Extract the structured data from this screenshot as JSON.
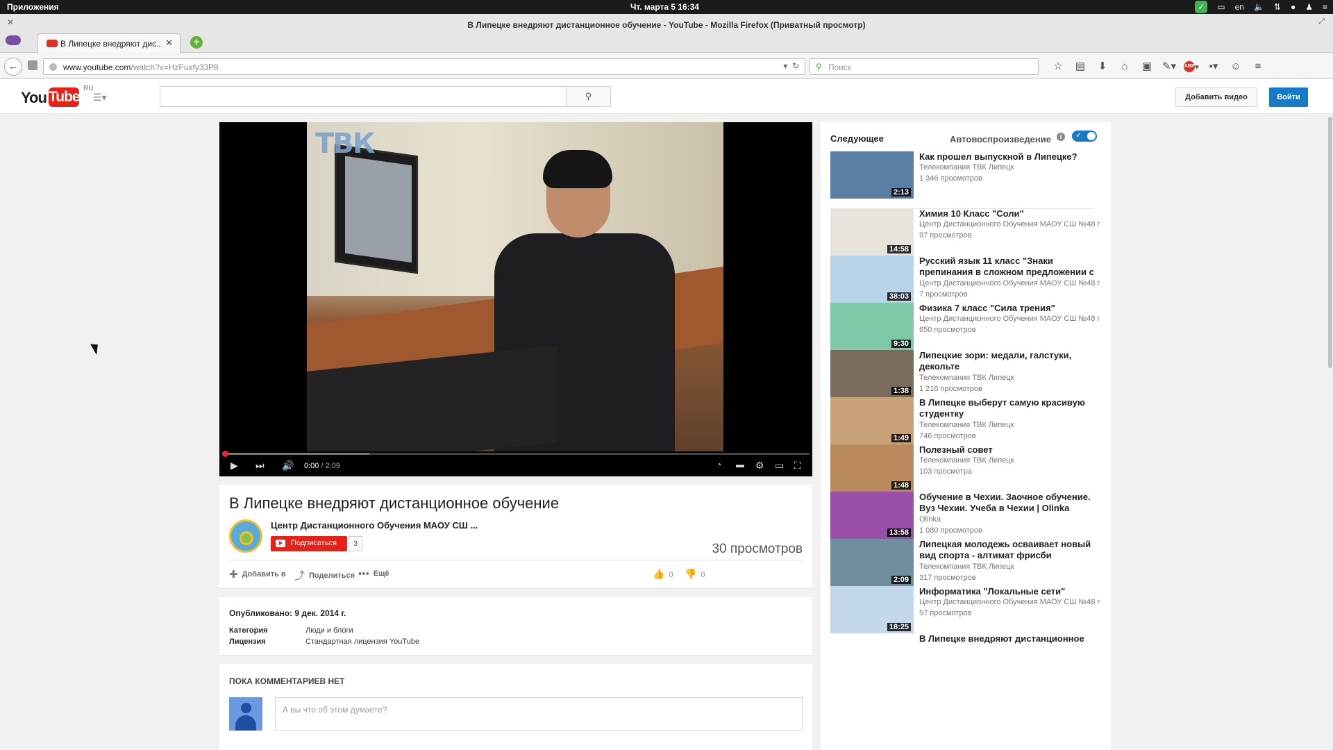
{
  "os": {
    "apps_menu": "Приложения",
    "clock": "Чт. марта  5 16:34",
    "tray": {
      "lang": "en"
    }
  },
  "window": {
    "title": "В Липецке внедряют дистанционное обучение - YouTube - Mozilla Firefox (Приватный просмотр)"
  },
  "tabs": [
    {
      "label": "В Липецке внедряют дис..."
    }
  ],
  "navbar": {
    "url_host": "www.youtube.com",
    "url_path": "/watch?v=HzFuxfy33P8",
    "search_placeholder": "Поиск"
  },
  "yt_header": {
    "logo_you": "You",
    "logo_tube": "Tube",
    "logo_region": "RU",
    "upload_label": "Добавить видео",
    "signin_label": "Войти"
  },
  "player": {
    "watermark": "ТВК",
    "current_time": "0:00",
    "duration": "/ 2:09",
    "progress": 0.0,
    "buffered": 0.25
  },
  "video": {
    "title": "В Липецке внедряют дистанционное обучение",
    "channel": "Центр Дистанционного Обучения МАОУ СШ ...",
    "subscribe_label": "Подписаться",
    "subscribers": "3",
    "views": "30 просмотров",
    "actions": {
      "add_to": "Добавить в",
      "share": "Поделиться",
      "more": "Ещё"
    },
    "likes": "0",
    "dislikes": "0"
  },
  "description": {
    "published": "Опубликовано: 9 дек. 2014 г.",
    "category_key": "Категория",
    "category_val": "Люди и блоги",
    "license_key": "Лицензия",
    "license_val": "Стандартная лицензия YouTube"
  },
  "comments": {
    "header": "ПОКА КОММЕНТАРИЕВ НЕТ",
    "placeholder": "А вы что об этом думаете?"
  },
  "sidebar": {
    "next_label": "Следующее",
    "autoplay_label": "Автовоспроизведение",
    "autoplay_on": true,
    "videos": [
      {
        "title": "Как прошел выпускной в Липецке?",
        "channel": "Телекомпания ТВК Липецк",
        "views": "1 346 просмотров",
        "duration": "2:13",
        "color": "#5b7fa3"
      },
      {
        "title": "Химия 10 Класс \"Соли\"",
        "channel": "Центр Дистанционного Обучения МАОУ СШ №48 г",
        "views": "97 просмотров",
        "duration": "14:58",
        "color": "#e8e4dc"
      },
      {
        "title": "Русский язык 11 класс \"Знаки препинания в сложном предложении с",
        "channel": "Центр Дистанционного Обучения МАОУ СШ №48 г",
        "views": "7 просмотров",
        "duration": "38:03",
        "color": "#b9d3ea"
      },
      {
        "title": "Физика 7 класс \"Сила трения\"",
        "channel": "Центр Дистанционного Обучения МАОУ СШ №48 г",
        "views": "650 просмотров",
        "duration": "9:30",
        "color": "#7fc8a8"
      },
      {
        "title": "Липецкие зори: медали, галстуки, декольте",
        "channel": "Телекомпания ТВК Липецк",
        "views": "1 216 просмотров",
        "duration": "1:38",
        "color": "#7a6c5d"
      },
      {
        "title": "В Липецке выберут самую красивую студентку",
        "channel": "Телекомпания ТВК Липецк",
        "views": "746 просмотров",
        "duration": "1:49",
        "color": "#c9a27a"
      },
      {
        "title": "Полезный совет",
        "channel": "Телекомпания ТВК Липецк",
        "views": "103 просмотра",
        "duration": "1:48",
        "color": "#b88a5c"
      },
      {
        "title": "Обучение в Чехии. Заочное обучение. Вуз Чехии. Учеба в Чехии | Olinka",
        "channel": "Olinka",
        "views": "1 080 просмотров",
        "duration": "13:58",
        "color": "#9a4fa8"
      },
      {
        "title": "Липецкая молодежь осваивает новый вид спорта - алтимат фрисби",
        "channel": "Телекомпания ТВК Липецк",
        "views": "317 просмотров",
        "duration": "2:09",
        "color": "#6f8fa0"
      },
      {
        "title": "Информатика \"Локальные сети\"",
        "channel": "Центр Дистанционного Обучения МАОУ СШ №48 г",
        "views": "57 просмотров",
        "duration": "18:25",
        "color": "#c3d8ec"
      },
      {
        "title": "В Липецке внедряют дистанционное",
        "channel": "",
        "views": "",
        "duration": "",
        "color": "#ffffff"
      }
    ]
  }
}
